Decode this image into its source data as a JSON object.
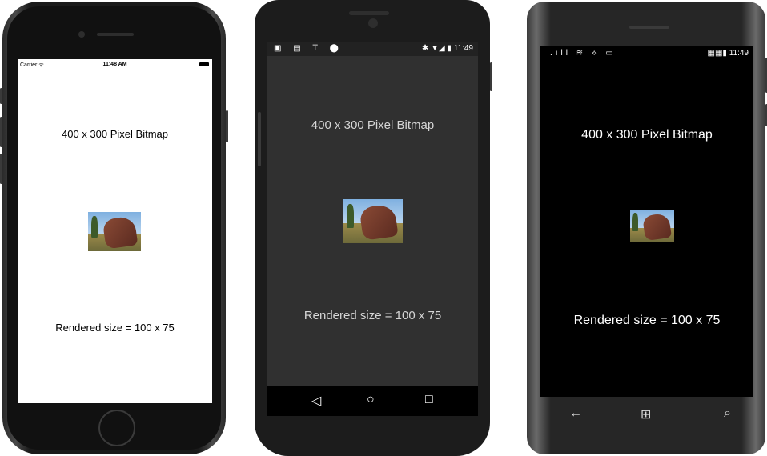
{
  "ios": {
    "status": {
      "carrier": "Carrier ᯤ",
      "time": "11:48 AM"
    },
    "title": "400 x 300 Pixel Bitmap",
    "rendered": "Rendered size = 100 x 75"
  },
  "android": {
    "status": {
      "left_icons": "▣ ▤ ₸ ⬤",
      "right_icons": "✱ ▼◢ ▮ 11:49"
    },
    "title": "400 x 300 Pixel Bitmap",
    "rendered": "Rendered size = 100 x 75",
    "nav": {
      "back": "◁",
      "home": "○",
      "recents": "□"
    }
  },
  "windows": {
    "status": {
      "left_icons": ".ıll ≋ ⟡ ▭",
      "right_icons": "▦▦▮ 11:49"
    },
    "title": "400 x 300 Pixel Bitmap",
    "rendered": "Rendered size = 100 x 75",
    "nav": {
      "back": "←",
      "start": "⊞",
      "search": "⌕"
    }
  },
  "colors": {
    "ios_screen_bg": "#ffffff",
    "android_screen_bg": "#303030",
    "windows_screen_bg": "#000000",
    "ios_text": "#000000",
    "android_text": "#d6d6d6",
    "windows_text": "#ffffff"
  }
}
